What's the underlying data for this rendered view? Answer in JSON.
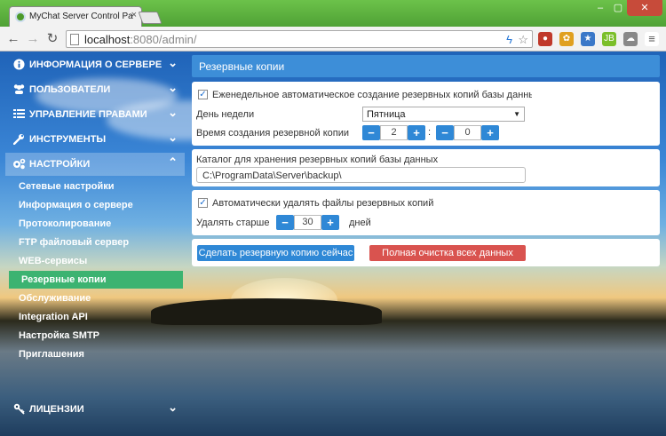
{
  "browser": {
    "tab_title": "MyChat Server Control Pa",
    "tab_close": "×",
    "url_host": "localhost",
    "url_rest": ":8080/admin/",
    "window_controls": [
      "–",
      "▢",
      "✕"
    ]
  },
  "sidebar": {
    "sections": [
      {
        "label": "ИНФОРМАЦИЯ О СЕРВЕРЕ",
        "icon": "info-icon"
      },
      {
        "label": "ПОЛЬЗОВАТЕЛИ",
        "icon": "users-icon"
      },
      {
        "label": "УПРАВЛЕНИЕ ПРАВАМИ",
        "icon": "list-icon"
      },
      {
        "label": "ИНСТРУМЕНТЫ",
        "icon": "wrench-icon"
      },
      {
        "label": "НАСТРОЙКИ",
        "icon": "gears-icon"
      }
    ],
    "items": [
      "Сетевые настройки",
      "Информация о сервере",
      "Протоколирование",
      "FTP файловый сервер",
      "WEB-сервисы",
      "Резервные копии",
      "Обслуживание",
      "Integration API",
      "Настройка SMTP",
      "Приглашения"
    ],
    "licenses": "ЛИЦЕНЗИИ"
  },
  "main": {
    "title": "Резервные копии",
    "weekly": {
      "checkbox_label": "Еженедельное автоматическое создание резервных копий базы данных с",
      "checked": true,
      "day_label": "День недели",
      "day_value": "Пятница",
      "time_label": "Время создания резервной копии",
      "hours": "2",
      "minutes": "0",
      "separator": ":"
    },
    "folder": {
      "label": "Каталог для хранения резервных копий базы данных",
      "path": "C:\\ProgramData\\Server\\backup\\"
    },
    "autodelete": {
      "checkbox_label": "Автоматически удалять файлы резервных копий",
      "checked": true,
      "older_label": "Удалять старше",
      "days_value": "30",
      "days_unit": "дней"
    },
    "actions": {
      "backup_now": "Сделать резервную копию сейчас",
      "full_clean": "Полная очистка всех данных"
    }
  },
  "colors": {
    "accent": "#2f88d6",
    "active_item": "#3cb371",
    "danger": "#d9534f"
  }
}
